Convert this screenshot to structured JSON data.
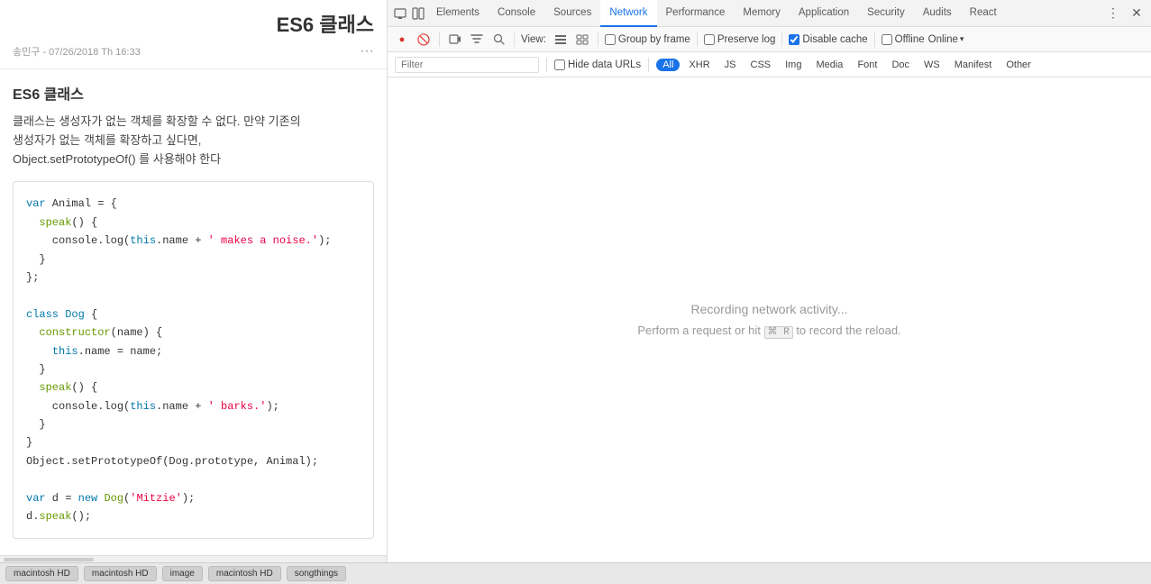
{
  "leftPanel": {
    "title": "ES6 클래스",
    "meta": {
      "author": "송민구",
      "date": "07/26/2018 Th 16:33"
    },
    "subtitle": "ES6 클래스",
    "text": "클래스는 생성자가 없는 객체를 확장할 수 없다. 만약 기존의\n생성자가 없는 객체를 확장하고 싶다면,\nObject.setPrototypeOf() 를 사용해야 한다",
    "code": "var Animal = {\n  speak() {\n    console.log(this.name + ' makes a noise.');\n  }\n};\n\nclass Dog {\n  constructor(name) {\n    this.name = name;\n  }\n  speak() {\n    console.log(this.name + ' barks.');\n  }\n}\nObject.setPrototypeOf(Dog.prototype, Animal);\n\nvar d = new Dog('Mitzie');\nd.speak();"
  },
  "devtools": {
    "tabs": [
      {
        "label": "Elements",
        "active": false
      },
      {
        "label": "Console",
        "active": false
      },
      {
        "label": "Sources",
        "active": false
      },
      {
        "label": "Network",
        "active": true
      },
      {
        "label": "Performance",
        "active": false
      },
      {
        "label": "Memory",
        "active": false
      },
      {
        "label": "Application",
        "active": false
      },
      {
        "label": "Security",
        "active": false
      },
      {
        "label": "Audits",
        "active": false
      },
      {
        "label": "React",
        "active": false
      }
    ],
    "toolbar": {
      "view_label": "View:",
      "group_by_frame": "Group by frame",
      "preserve_log": "Preserve log",
      "disable_cache": "Disable cache",
      "offline": "Offline",
      "online": "Online"
    },
    "filterBar": {
      "placeholder": "Filter",
      "hide_data_urls": "Hide data URLs",
      "types": [
        "All",
        "XHR",
        "JS",
        "CSS",
        "Img",
        "Media",
        "Font",
        "Doc",
        "WS",
        "Manifest",
        "Other"
      ]
    },
    "networkMessage": {
      "line1": "Recording network activity...",
      "line2": "Perform a request or hit ⌘ R to record the reload."
    }
  },
  "taskbar": {
    "items": [
      "macintosh HD",
      "macintosh HD",
      "image",
      "macintosh HD",
      "songthings"
    ]
  },
  "icons": {
    "record": "●",
    "stop": "⊘",
    "video": "▶",
    "filter": "⊟",
    "search": "🔍",
    "list": "≡",
    "list2": "⊞",
    "more": "⋮",
    "close": "✕",
    "chevron": "▾",
    "arrow_down": "▾"
  }
}
